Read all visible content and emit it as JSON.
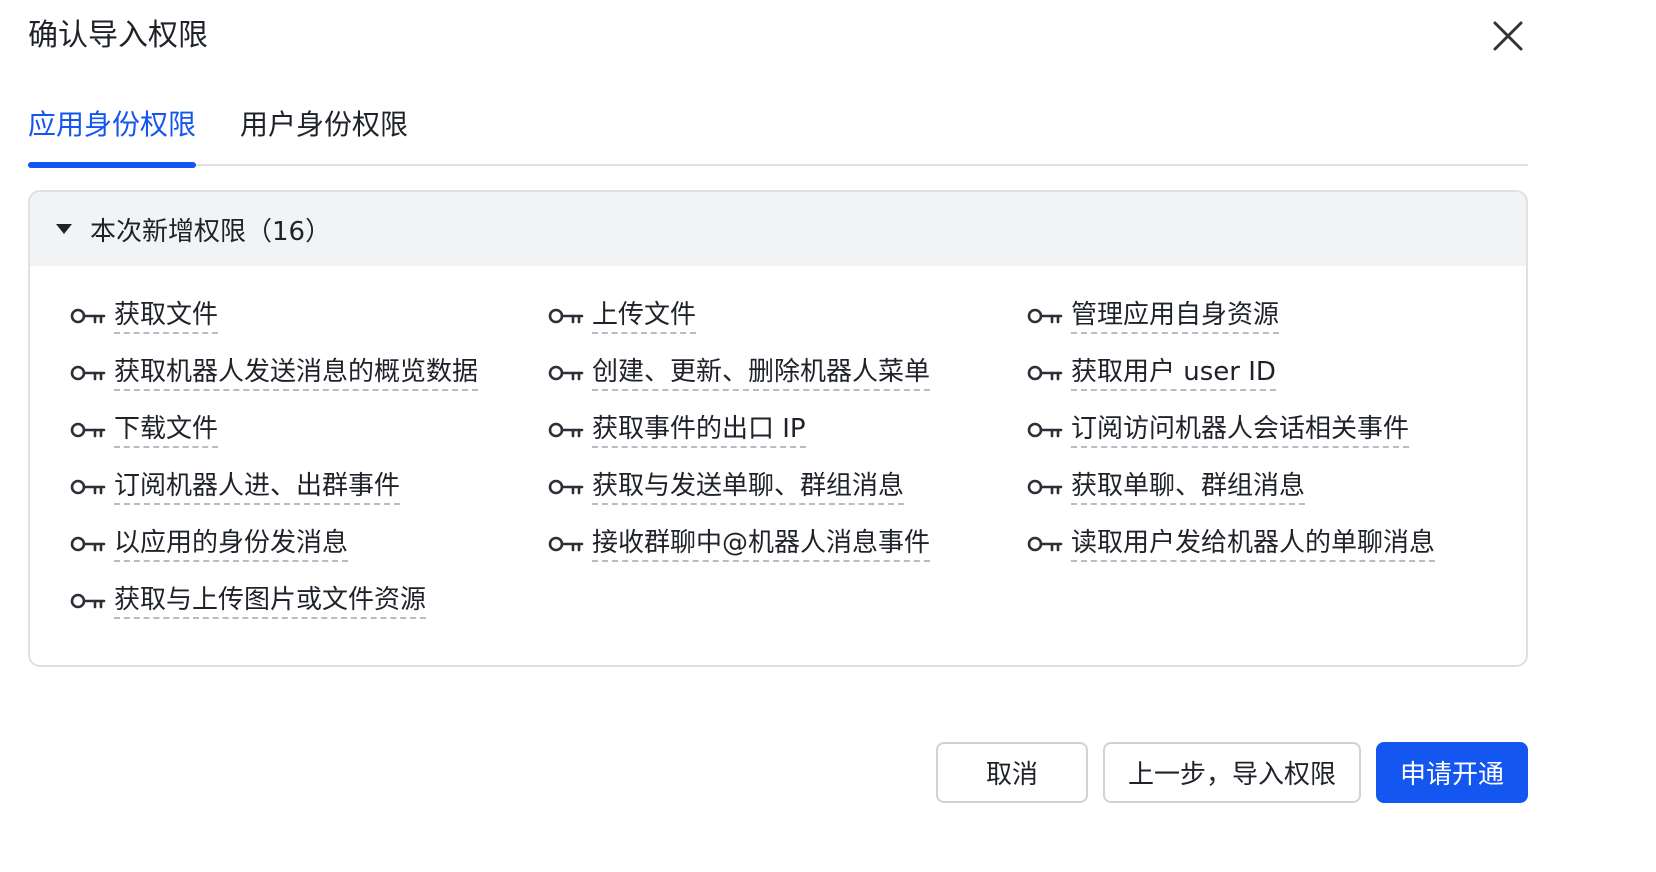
{
  "dialog": {
    "title": "确认导入权限"
  },
  "tabs": [
    {
      "label": "应用身份权限",
      "active": true
    },
    {
      "label": "用户身份权限",
      "active": false
    }
  ],
  "panel": {
    "title": "本次新增权限（16）",
    "columns": [
      [
        "获取文件",
        "获取机器人发送消息的概览数据",
        "下载文件",
        "订阅机器人进、出群事件",
        "以应用的身份发消息",
        "获取与上传图片或文件资源"
      ],
      [
        "上传文件",
        "创建、更新、删除机器人菜单",
        "获取事件的出口 IP",
        "获取与发送单聊、群组消息",
        "接收群聊中@机器人消息事件"
      ],
      [
        "管理应用自身资源",
        "获取用户 user ID",
        "订阅访问机器人会话相关事件",
        "获取单聊、群组消息",
        "读取用户发给机器人的单聊消息"
      ]
    ]
  },
  "footer": {
    "cancel_label": "取消",
    "back_label": "上一步，导入权限",
    "submit_label": "申请开通"
  },
  "colors": {
    "accent": "#1456f0",
    "text": "#1f2329",
    "border": "#dee0e3",
    "header_bg": "#f2f3f5"
  }
}
